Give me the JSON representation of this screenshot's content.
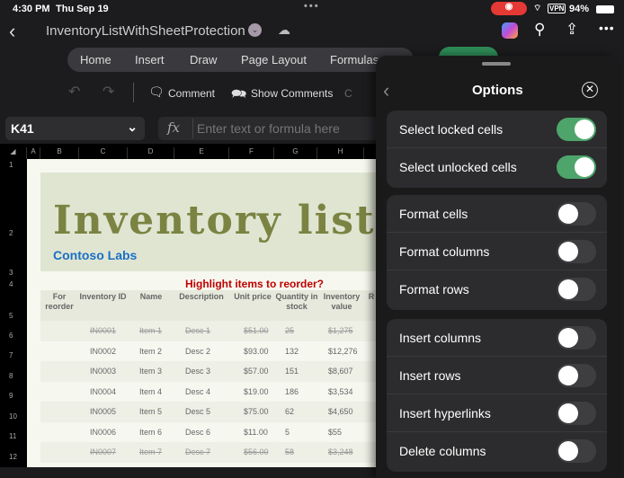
{
  "status": {
    "time": "4:30 PM",
    "date": "Thu Sep 19",
    "vpn": "VPN",
    "battery": "94%"
  },
  "title": {
    "doc_name": "InventoryListWithSheetProtection"
  },
  "ribbon": {
    "tabs": [
      "Home",
      "Insert",
      "Draw",
      "Page Layout",
      "Formulas"
    ]
  },
  "toolbar": {
    "comment": "Comment",
    "show_comments": "Show Comments",
    "partial": "C"
  },
  "formula": {
    "cell_ref": "K41",
    "placeholder": "Enter text or formula here"
  },
  "sheet": {
    "columns": [
      "A",
      "B",
      "C",
      "D",
      "E",
      "F",
      "G",
      "H"
    ],
    "rows": [
      "1",
      "2",
      "3",
      "4",
      "5",
      "6",
      "7",
      "8",
      "9",
      "10",
      "11",
      "12"
    ],
    "title": "Inventory list",
    "company": "Contoso Labs",
    "highlight": "Highlight items to reorder?",
    "headers": [
      "For reorder",
      "Inventory ID",
      "Name",
      "Description",
      "Unit price",
      "Quantity in stock",
      "Inventory value",
      "R"
    ],
    "data": [
      {
        "id": "IN0001",
        "name": "Item 1",
        "desc": "Desc 1",
        "price": "$51.00",
        "qty": "25",
        "value": "$1,275",
        "discontinued": true
      },
      {
        "id": "IN0002",
        "name": "Item 2",
        "desc": "Desc 2",
        "price": "$93.00",
        "qty": "132",
        "value": "$12,276",
        "discontinued": false
      },
      {
        "id": "IN0003",
        "name": "Item 3",
        "desc": "Desc 3",
        "price": "$57.00",
        "qty": "151",
        "value": "$8,607",
        "discontinued": false
      },
      {
        "id": "IN0004",
        "name": "Item 4",
        "desc": "Desc 4",
        "price": "$19.00",
        "qty": "186",
        "value": "$3,534",
        "discontinued": false
      },
      {
        "id": "IN0005",
        "name": "Item 5",
        "desc": "Desc 5",
        "price": "$75.00",
        "qty": "62",
        "value": "$4,650",
        "discontinued": false
      },
      {
        "id": "IN0006",
        "name": "Item 6",
        "desc": "Desc 6",
        "price": "$11.00",
        "qty": "5",
        "value": "$55",
        "discontinued": false
      },
      {
        "id": "IN0007",
        "name": "Item 7",
        "desc": "Desc 7",
        "price": "$56.00",
        "qty": "58",
        "value": "$3,248",
        "discontinued": true
      }
    ]
  },
  "panel": {
    "title": "Options",
    "groups": [
      [
        {
          "label": "Select locked cells",
          "on": true
        },
        {
          "label": "Select unlocked cells",
          "on": true
        }
      ],
      [
        {
          "label": "Format cells",
          "on": false
        },
        {
          "label": "Format columns",
          "on": false
        },
        {
          "label": "Format rows",
          "on": false
        }
      ],
      [
        {
          "label": "Insert columns",
          "on": false
        },
        {
          "label": "Insert rows",
          "on": false
        },
        {
          "label": "Insert hyperlinks",
          "on": false
        },
        {
          "label": "Delete columns",
          "on": false
        }
      ]
    ]
  },
  "colors": {
    "toggle_on": "#4ea56c",
    "title_green": "#7a8341",
    "company_blue": "#1a6fc4",
    "highlight_red": "#c00000"
  }
}
